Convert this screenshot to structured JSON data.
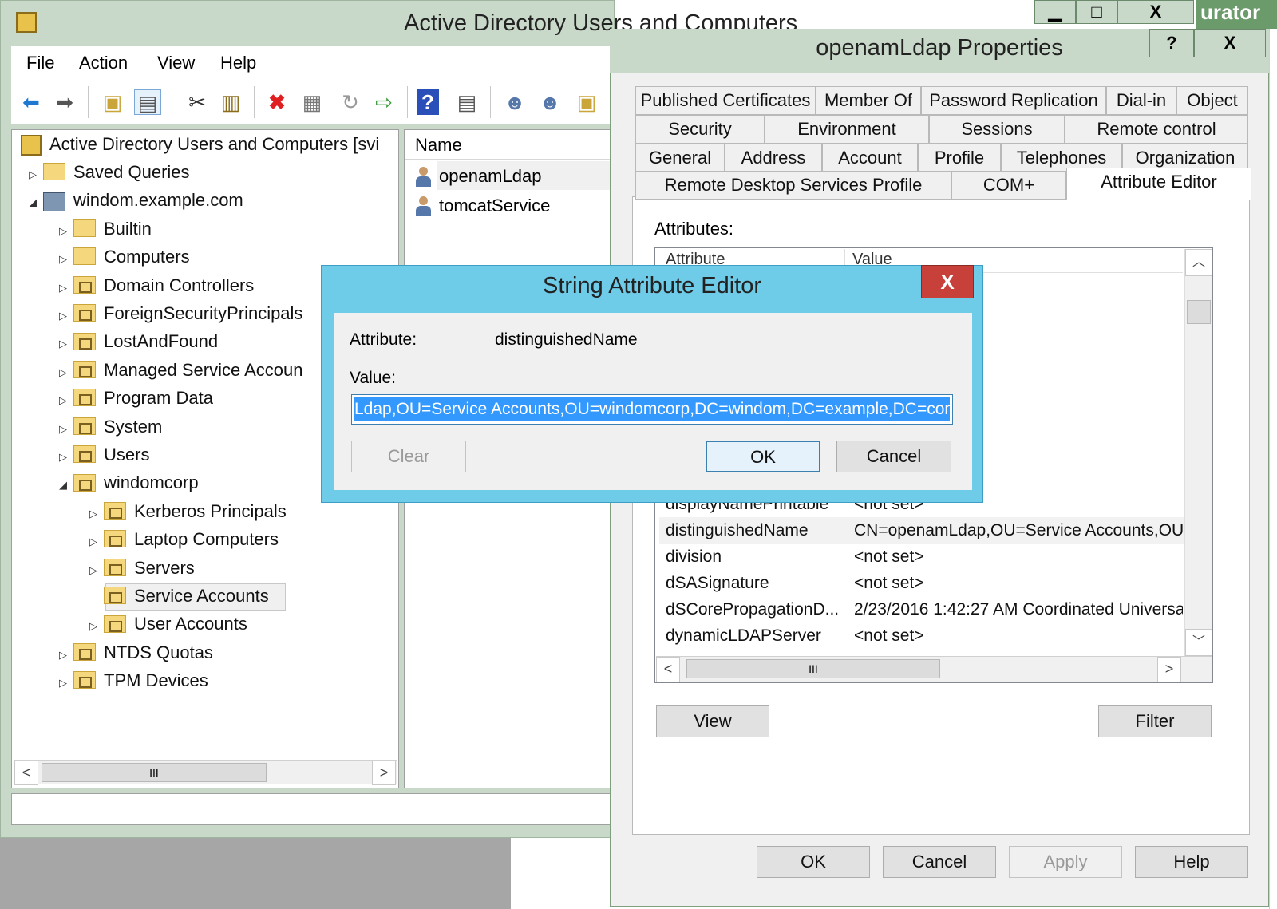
{
  "mmc": {
    "title": "Active Directory Users and Computers",
    "controls": {
      "minimize": "▁",
      "maximize": "□",
      "close": "X"
    },
    "menu": [
      "File",
      "Action",
      "View",
      "Help"
    ]
  },
  "background": {
    "admin_fragment": "urator"
  },
  "tree": {
    "root": "Active Directory Users and Computers [svi",
    "items": [
      {
        "label": "Saved Queries",
        "level": 1,
        "expander": "▷"
      },
      {
        "label": "windom.example.com",
        "level": 1,
        "expander": "◢"
      },
      {
        "label": "Builtin",
        "level": 2,
        "expander": "▷"
      },
      {
        "label": "Computers",
        "level": 2,
        "expander": "▷"
      },
      {
        "label": "Domain Controllers",
        "level": 2,
        "expander": "▷"
      },
      {
        "label": "ForeignSecurityPrincipals",
        "level": 2,
        "expander": "▷"
      },
      {
        "label": "LostAndFound",
        "level": 2,
        "expander": "▷"
      },
      {
        "label": "Managed Service Accoun",
        "level": 2,
        "expander": "▷"
      },
      {
        "label": "Program Data",
        "level": 2,
        "expander": "▷"
      },
      {
        "label": "System",
        "level": 2,
        "expander": "▷"
      },
      {
        "label": "Users",
        "level": 2,
        "expander": "▷"
      },
      {
        "label": "windomcorp",
        "level": 2,
        "expander": "◢"
      },
      {
        "label": "Kerberos Principals",
        "level": 3,
        "expander": "▷"
      },
      {
        "label": "Laptop Computers",
        "level": 3,
        "expander": "▷"
      },
      {
        "label": "Servers",
        "level": 3,
        "expander": "▷"
      },
      {
        "label": "Service Accounts",
        "level": 3,
        "expander": ""
      },
      {
        "label": "User Accounts",
        "level": 3,
        "expander": "▷"
      },
      {
        "label": "NTDS Quotas",
        "level": 2,
        "expander": "▷"
      },
      {
        "label": "TPM Devices",
        "level": 2,
        "expander": "▷"
      }
    ],
    "scroll_thumb": "III"
  },
  "list": {
    "column": "Name",
    "items": [
      "openamLdap",
      "tomcatService"
    ]
  },
  "properties": {
    "title": "openamLdap Properties",
    "help_btn": "?",
    "close_btn": "X",
    "tabs_row1": [
      "Published Certificates",
      "Member Of",
      "Password Replication",
      "Dial-in",
      "Object"
    ],
    "tabs_row2": [
      "Security",
      "Environment",
      "Sessions",
      "Remote control"
    ],
    "tabs_row3": [
      "General",
      "Address",
      "Account",
      "Profile",
      "Telephones",
      "Organization"
    ],
    "tabs_row4": [
      "Remote Desktop Services Profile",
      "COM+",
      "Attribute Editor"
    ],
    "attributes_label": "Attributes:",
    "columns": [
      "Attribute",
      "Value"
    ],
    "rows": [
      {
        "attr": "displayNamePrintable",
        "value": "<not set>"
      },
      {
        "attr": "distinguishedName",
        "value": "CN=openamLdap,OU=Service Accounts,OU"
      },
      {
        "attr": "division",
        "value": "<not set>"
      },
      {
        "attr": "dSASignature",
        "value": "<not set>"
      },
      {
        "attr": "dSCorePropagationD...",
        "value": "2/23/2016 1:42:27 AM Coordinated Universa"
      },
      {
        "attr": "dynamicLDAPServer",
        "value": "<not set>"
      }
    ],
    "scroll_thumb": "III",
    "view_btn": "View",
    "filter_btn": "Filter",
    "ok_btn": "OK",
    "cancel_btn": "Cancel",
    "apply_btn": "Apply",
    "help_bottom_btn": "Help"
  },
  "string_editor": {
    "title": "String Attribute Editor",
    "close": "X",
    "attribute_label": "Attribute:",
    "attribute_name": "distinguishedName",
    "value_label": "Value:",
    "value": "Ldap,OU=Service Accounts,OU=windomcorp,DC=windom,DC=example,DC=com",
    "clear_btn": "Clear",
    "ok_btn": "OK",
    "cancel_btn": "Cancel"
  },
  "colors": {
    "mmc_frame": "#c9d9c9",
    "editor_frame": "#6fcce8",
    "close_red": "#c7403a",
    "selection_blue": "#3399ff"
  },
  "icons": [
    "back-arrow-icon",
    "forward-arrow-icon",
    "up-folder-icon",
    "show-tree-icon",
    "cut-icon",
    "paste-icon",
    "delete-icon",
    "properties-icon",
    "refresh-icon",
    "export-icon",
    "help-icon",
    "console-icon",
    "new-user-icon",
    "new-group-icon",
    "new-ou-icon"
  ]
}
